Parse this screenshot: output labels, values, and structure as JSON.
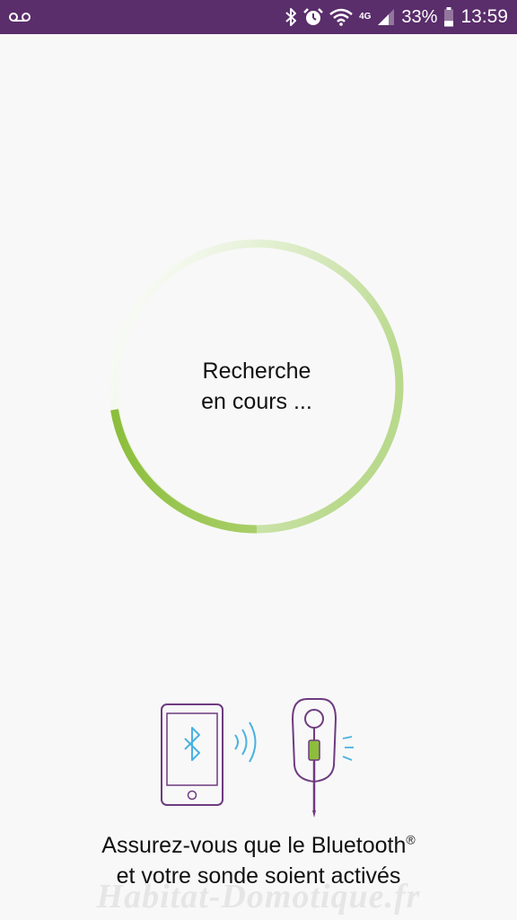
{
  "status_bar": {
    "left_icon": "voicemail-icon",
    "icons": [
      "bluetooth-icon",
      "alarm-icon",
      "wifi-icon",
      "network-4g-icon",
      "signal-icon",
      "battery-icon"
    ],
    "network_label": "4G",
    "battery_percent": "33%",
    "battery_level": 0.33,
    "time": "13:59",
    "background_color": "#5a2d6b"
  },
  "search": {
    "line1": "Recherche",
    "line2": "en cours ...",
    "ring_track_color": "#e8f3d8",
    "ring_active_color": "#8cbe3c"
  },
  "illustration": {
    "phone_icon": "phone-bluetooth-icon",
    "waves_icon": "signal-waves-icon",
    "probe_icon": "thermometer-probe-icon",
    "outline_color": "#6e3b80",
    "bluetooth_color": "#4ab2e0",
    "probe_accent_color": "#8cbe3c"
  },
  "message": {
    "line1": "Assurez-vous que le Bluetooth",
    "registered_mark": "®",
    "line2": "et votre sonde soient activés"
  },
  "watermark": {
    "text": "Habitat-Domotique.fr"
  }
}
